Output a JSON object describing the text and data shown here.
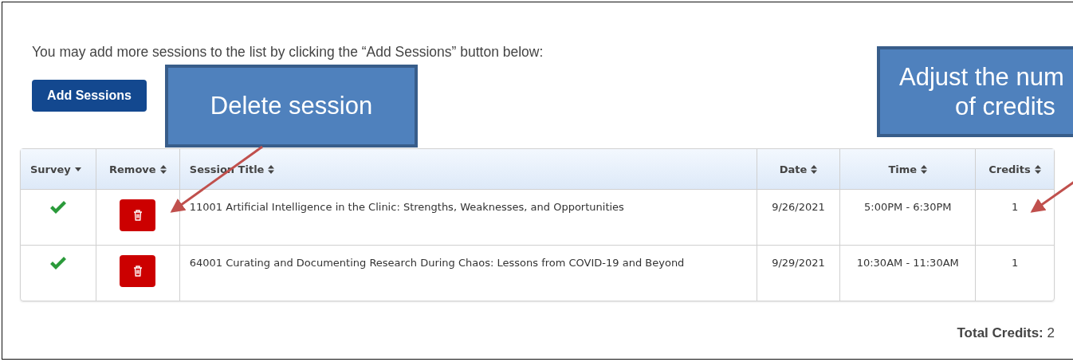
{
  "intro": "You may add more sessions to the list by clicking the “Add Sessions” button below:",
  "add_button": "Add Sessions",
  "table": {
    "columns": [
      {
        "label": "Survey",
        "sorted": true
      },
      {
        "label": "Remove",
        "sorted": false
      },
      {
        "label": "Session Title",
        "sorted": false
      },
      {
        "label": "Date",
        "sorted": false
      },
      {
        "label": "Time",
        "sorted": false
      },
      {
        "label": "Credits",
        "sorted": false
      }
    ],
    "rows": [
      {
        "survey_done": true,
        "title": "11001 Artificial Intelligence in the Clinic: Strengths, Weaknesses, and Opportunities",
        "date": "9/26/2021",
        "time": "5:00PM - 6:30PM",
        "credits": "1"
      },
      {
        "survey_done": true,
        "title": "64001 Curating and Documenting Research During Chaos: Lessons from COVID-19 and Beyond",
        "date": "9/29/2021",
        "time": "10:30AM - 11:30AM",
        "credits": "1"
      }
    ]
  },
  "total": {
    "label": "Total Credits:",
    "value": "2"
  },
  "callouts": [
    {
      "lines": [
        "Delete session"
      ]
    },
    {
      "lines": [
        "Adjust the num",
        "of credits"
      ]
    }
  ]
}
